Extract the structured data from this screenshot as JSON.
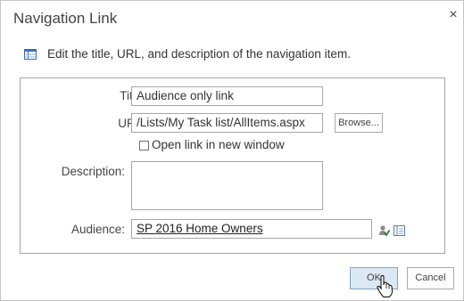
{
  "dialog": {
    "title": "Navigation Link",
    "close_glyph": "×",
    "info_icon": "list-icon",
    "info_text": "Edit the title, URL, and description of the navigation item."
  },
  "form": {
    "title_label": "Title:",
    "title_value": "Audience only link",
    "url_label": "URL:",
    "url_value": "/Lists/My Task list/AllItems.aspx",
    "browse_label": "Browse...",
    "new_window_label": "Open link in new window",
    "new_window_checked": false,
    "description_label": "Description:",
    "description_value": "",
    "audience_label": "Audience:",
    "audience_value": "SP 2016 Home Owners",
    "check_names_icon": "check-names-icon",
    "browse_people_icon": "address-book-icon"
  },
  "footer": {
    "ok_label": "OK",
    "cancel_label": "Cancel"
  },
  "cursor": "hand-pointer-icon"
}
